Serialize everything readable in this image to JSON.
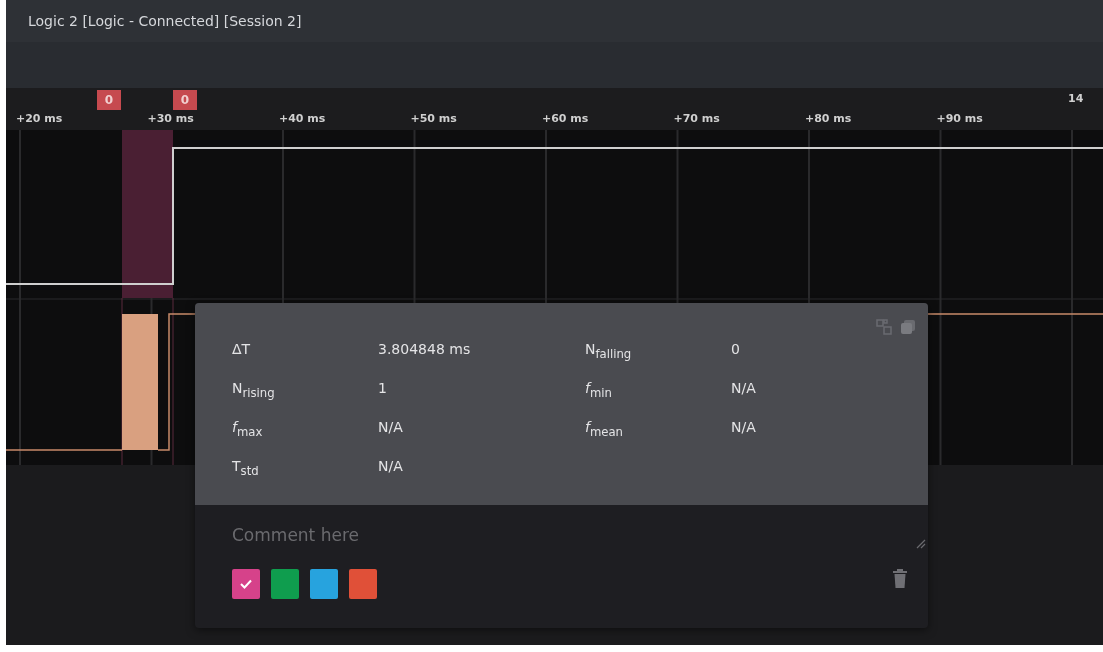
{
  "window": {
    "title": "Logic 2 [Logic - Connected] [Session 2]"
  },
  "ruler": {
    "ticks": [
      "+20 ms",
      "+30 ms",
      "+40 ms",
      "+50 ms",
      "+60 ms",
      "+70 ms",
      "+80 ms",
      "+90 ms",
      "14"
    ]
  },
  "markers": [
    {
      "label": "0"
    },
    {
      "label": "0"
    }
  ],
  "popup": {
    "stats": [
      {
        "label": "ΔT",
        "value": "3.804848 ms"
      },
      {
        "label": "N$_{falling}$",
        "value": "0"
      },
      {
        "label": "N$_{rising}$",
        "value": "1"
      },
      {
        "label": "*f*$_{min}$",
        "value": "N/A"
      },
      {
        "label": "*f*$_{max}$",
        "value": "N/A"
      },
      {
        "label": "*f*$_{mean}$",
        "value": "N/A"
      },
      {
        "label": "T$_{std}$",
        "value": "N/A"
      }
    ],
    "comment": {
      "placeholder": "Comment here"
    },
    "colors": [
      {
        "color": "#d6428a",
        "selected": true
      },
      {
        "color": "#0f9d4e",
        "selected": false
      },
      {
        "color": "#27a3de",
        "selected": false
      },
      {
        "color": "#e05038",
        "selected": false
      }
    ]
  }
}
